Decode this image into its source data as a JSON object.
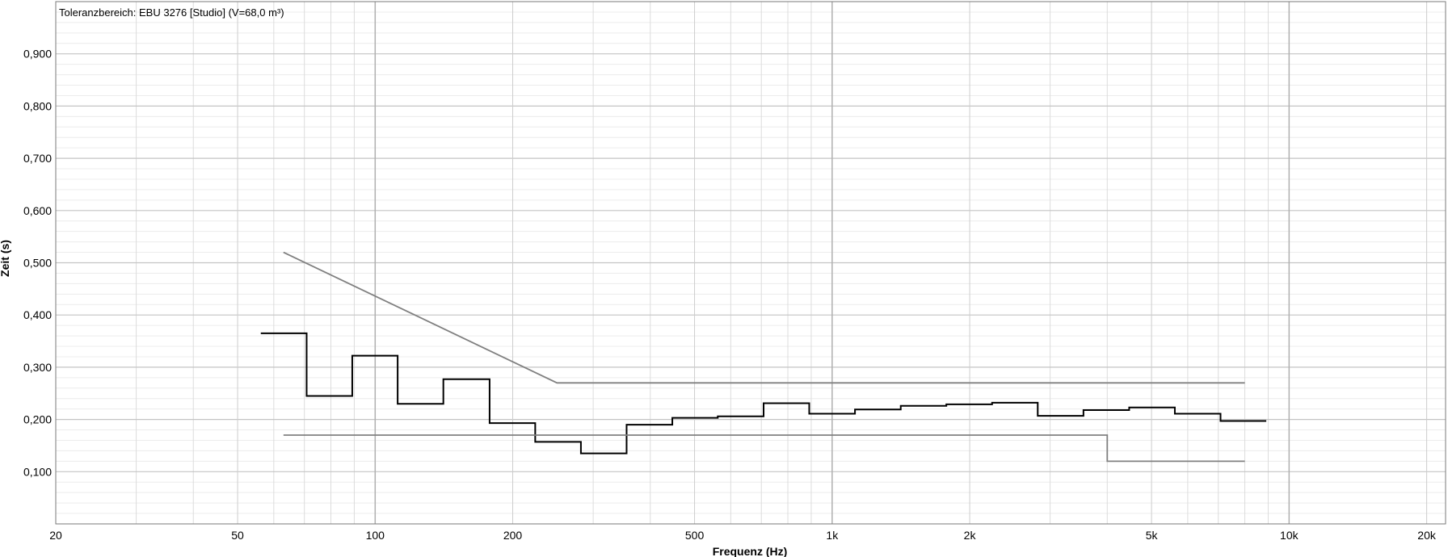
{
  "chart_data": {
    "type": "line",
    "title": "Toleranzbereich: EBU 3276 [Studio] (V=68,0 m³)",
    "xlabel": "Frequenz (Hz)",
    "ylabel": "Zeit (s)",
    "x_scale": "log",
    "xlim": [
      20,
      22000
    ],
    "ylim": [
      0,
      1.0
    ],
    "x_tick_values": [
      20,
      50,
      100,
      200,
      500,
      1000,
      2000,
      5000,
      10000,
      20000
    ],
    "x_tick_labels": [
      "20",
      "50",
      "100",
      "200",
      "500",
      "1k",
      "2k",
      "5k",
      "10k",
      "20k"
    ],
    "y_tick_values": [
      0.1,
      0.2,
      0.3,
      0.4,
      0.5,
      0.6,
      0.7,
      0.8,
      0.9
    ],
    "y_tick_labels": [
      "0,100",
      "0,200",
      "0,300",
      "0,400",
      "0,500",
      "0,600",
      "0,700",
      "0,800",
      "0,900"
    ],
    "grid": true,
    "legend": "none",
    "series": [
      {
        "style": "step",
        "color": "#000000",
        "bands": [
          {
            "x0": 56.2,
            "x1": 70.8,
            "y": 0.365
          },
          {
            "x0": 70.8,
            "x1": 89.1,
            "y": 0.245
          },
          {
            "x0": 89.1,
            "x1": 112,
            "y": 0.322
          },
          {
            "x0": 112,
            "x1": 141,
            "y": 0.23
          },
          {
            "x0": 141,
            "x1": 178,
            "y": 0.277
          },
          {
            "x0": 178,
            "x1": 224,
            "y": 0.193
          },
          {
            "x0": 224,
            "x1": 282,
            "y": 0.157
          },
          {
            "x0": 282,
            "x1": 355,
            "y": 0.135
          },
          {
            "x0": 355,
            "x1": 447,
            "y": 0.19
          },
          {
            "x0": 447,
            "x1": 562,
            "y": 0.203
          },
          {
            "x0": 562,
            "x1": 708,
            "y": 0.206
          },
          {
            "x0": 708,
            "x1": 891,
            "y": 0.231
          },
          {
            "x0": 891,
            "x1": 1122,
            "y": 0.211
          },
          {
            "x0": 1122,
            "x1": 1413,
            "y": 0.219
          },
          {
            "x0": 1413,
            "x1": 1778,
            "y": 0.226
          },
          {
            "x0": 1778,
            "x1": 2239,
            "y": 0.229
          },
          {
            "x0": 2239,
            "x1": 2818,
            "y": 0.232
          },
          {
            "x0": 2818,
            "x1": 3548,
            "y": 0.207
          },
          {
            "x0": 3548,
            "x1": 4467,
            "y": 0.218
          },
          {
            "x0": 4467,
            "x1": 5623,
            "y": 0.223
          },
          {
            "x0": 5623,
            "x1": 7079,
            "y": 0.211
          },
          {
            "x0": 7079,
            "x1": 8913,
            "y": 0.197
          }
        ]
      },
      {
        "style": "polyline",
        "color": "#808080",
        "points": [
          [
            63,
            0.52
          ],
          [
            250,
            0.27
          ],
          [
            8000,
            0.27
          ]
        ]
      },
      {
        "style": "polyline",
        "color": "#808080",
        "points": [
          [
            63,
            0.17
          ],
          [
            4000,
            0.17
          ],
          [
            4000,
            0.12
          ],
          [
            8000,
            0.12
          ]
        ]
      }
    ]
  }
}
